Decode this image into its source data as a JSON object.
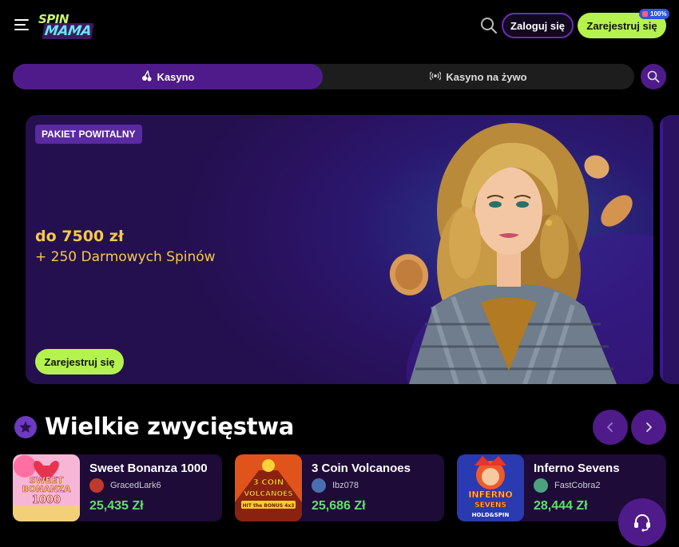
{
  "header": {
    "logo_top": "SPIN",
    "logo_bottom": "MAMA",
    "login_label": "Zaloguj się",
    "register_label": "Zarejestruj się",
    "badge_text": "100%"
  },
  "tabs": [
    {
      "label": "Kasyno",
      "icon": "cherries-icon",
      "active": true
    },
    {
      "label": "Kasyno na żywo",
      "icon": "live-broadcast-icon",
      "active": false
    }
  ],
  "banner": {
    "tag": "PAKIET POWITALNY",
    "amount": "do 7500 zł",
    "spins": "+ 250 Darmowych Spinów",
    "cta": "Zarejestruj się"
  },
  "big_wins": {
    "title": "Wielkie zwycięstwa",
    "items": [
      {
        "game": "Sweet Bonanza 1000",
        "player": "GracedLark6",
        "amount": "25,435 Zł",
        "thumb_lines": [
          "SWEET",
          "BONANZA",
          "1000"
        ]
      },
      {
        "game": "3 Coin Volcanoes",
        "player": "Ibz078",
        "amount": "25,686 Zł",
        "thumb_lines": [
          "3 COIN",
          "VOLCANOES",
          "HIT the BONUS 4x3"
        ]
      },
      {
        "game": "Inferno Sevens",
        "player": "FastCobra2",
        "amount": "28,444 Zł",
        "thumb_lines": [
          "INFERNO",
          "SEVENS",
          "HOLD&SPIN"
        ]
      }
    ]
  },
  "colors": {
    "accent_purple": "#4f1b8a",
    "cta_green": "#b4f24e",
    "win_green": "#5ee26b",
    "promo_gold": "#f5c84a"
  }
}
